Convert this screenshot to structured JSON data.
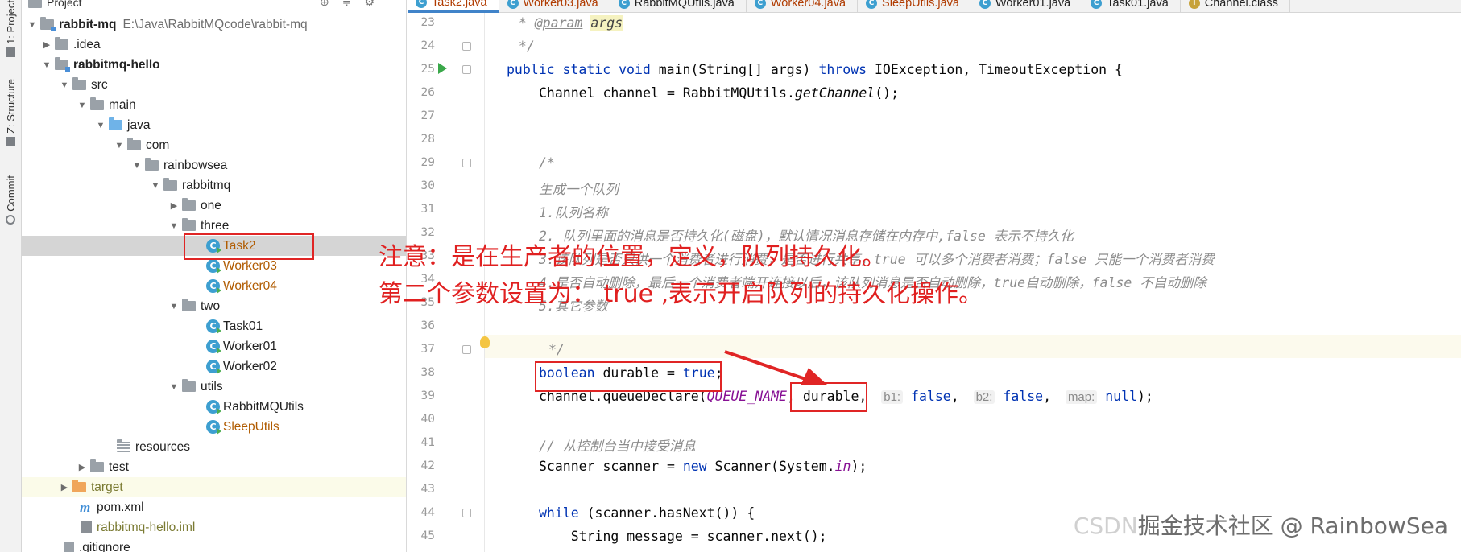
{
  "toolstrip": {
    "tabs": [
      {
        "label": "1: Project"
      },
      {
        "label": "Z: Structure"
      },
      {
        "label": "Commit"
      }
    ]
  },
  "project": {
    "header": "Project",
    "tree": [
      {
        "label": "rabbit-mq",
        "path": "E:\\Java\\RabbitMQcode\\rabbit-mq"
      },
      {
        "label": ".idea"
      },
      {
        "label": "rabbitmq-hello"
      },
      {
        "label": "src"
      },
      {
        "label": "main"
      },
      {
        "label": "java"
      },
      {
        "label": "com"
      },
      {
        "label": "rainbowsea"
      },
      {
        "label": "rabbitmq"
      },
      {
        "label": "one"
      },
      {
        "label": "three"
      },
      {
        "label": "Task2"
      },
      {
        "label": "Worker03"
      },
      {
        "label": "Worker04"
      },
      {
        "label": "two"
      },
      {
        "label": "Task01"
      },
      {
        "label": "Worker01"
      },
      {
        "label": "Worker02"
      },
      {
        "label": "utils"
      },
      {
        "label": "RabbitMQUtils"
      },
      {
        "label": "SleepUtils"
      },
      {
        "label": "resources"
      },
      {
        "label": "test"
      },
      {
        "label": "target"
      },
      {
        "label": "pom.xml"
      },
      {
        "label": "rabbitmq-hello.iml"
      },
      {
        "label": ".gitignore"
      }
    ]
  },
  "tabs": [
    {
      "label": "Task2.java"
    },
    {
      "label": "Worker03.java"
    },
    {
      "label": "RabbitMQUtils.java"
    },
    {
      "label": "Worker04.java"
    },
    {
      "label": "SleepUtils.java"
    },
    {
      "label": "Worker01.java"
    },
    {
      "label": "Task01.java"
    },
    {
      "label": "Channel.class"
    }
  ],
  "editor": {
    "line_numbers": [
      "23",
      "24",
      "25",
      "26",
      "27",
      "28",
      "29",
      "30",
      "31",
      "32",
      "33",
      "34",
      "35",
      "36",
      "37",
      "38",
      "39",
      "40",
      "41",
      "42",
      "43",
      "44",
      "45"
    ],
    "code": {
      "l23_star": " * ",
      "l23_tag": "@param",
      "l23_args": "args",
      "l24": " */",
      "l25_kw": "public static void",
      "l25_main": "main(String[] args)",
      "l25_throws": "throws",
      "l25_rest": "IOException, TimeoutException {",
      "l26_a": "Channel channel = RabbitMQUtils.",
      "l26_b": "getChannel",
      "l26_c": "();",
      "l29": "/*",
      "l30": "生成一个队列",
      "l31": "1.队列名称",
      "l32": "2. 队列里面的消息是否持久化(磁盘)，默认情况消息存储在内存中,false 表示不持久化",
      "l33": "3.该队列是否只供一个消费者进行消费，是否进行共享，true 可以多个消费者消费；false 只能一个消费者消费",
      "l34": "4.是否自动删除，最后一个消费者端开连接以后，该队列消息是否自动删除，true自动删除，false 不自动删除",
      "l35": "5.其它参数",
      "l37": "*/",
      "l38_kw": "boolean",
      "l38_mid": " durable = ",
      "l38_val": "true",
      "l38_end": ";",
      "l39_a": "channel.queueDeclare(",
      "l39_const": "QUEUE_NAME",
      "l39_b": ", durable, ",
      "l39_h1": "b1:",
      "l39_v1": "false",
      "l39_h2": "b2:",
      "l39_v2": "false",
      "l39_h3": "map:",
      "l39_v3": "null",
      "l39_end": ");",
      "l41": "// 从控制台当中接受消息",
      "l42_a": "Scanner scanner = ",
      "l42_new": "new",
      "l42_b": " Scanner(System.",
      "l42_in": "in",
      "l42_c": ");",
      "l44_kw": "while",
      "l44_rest": " (scanner.hasNext()) {",
      "l45": "    String message = scanner.next();"
    }
  },
  "annotation": {
    "line1": "注意：是在生产者的位置，定义，队列持久化。",
    "line2": "第二个参数设置为： true ,表示开启队列的持久化操作。"
  },
  "watermark": {
    "text1": "CSDN",
    "text2": "掘金技术社区 @ RainbowSea"
  },
  "colors": {
    "annotation_red": "#e02020",
    "keyword_blue": "#0033b3",
    "selection_gray": "#d5d5d5"
  }
}
